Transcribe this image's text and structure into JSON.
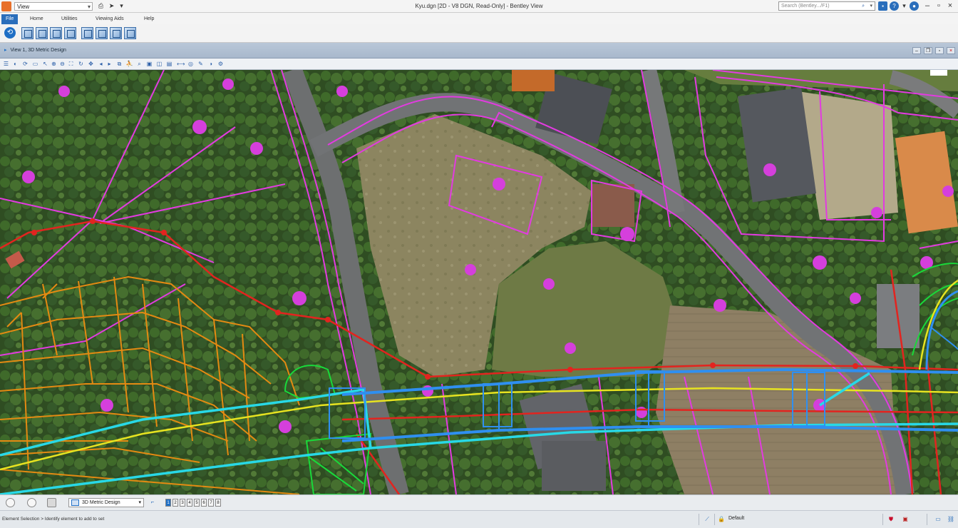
{
  "titlebar": {
    "workflow_value": "View",
    "window_title": "Kyu.dgn [2D - V8 DGN, Read-Only] - Bentley View",
    "search_placeholder": "Search (Bentley.../F1)"
  },
  "ribbon": {
    "tabs": [
      "File",
      "Home",
      "Utilities",
      "Viewing Aids",
      "Help"
    ]
  },
  "view": {
    "title": "View 1, 3D Metric Design"
  },
  "status": {
    "active_model": "3D Metric Design",
    "view_numbers": [
      "1",
      "2",
      "3",
      "4",
      "5",
      "6",
      "7",
      "8"
    ],
    "prompt": "Element Selection > Identify element to add to set",
    "level": "Default"
  },
  "colors": {
    "accent": "#2a6ebb",
    "magenta_linework": "#e23be0",
    "red_alignment": "#e2241f",
    "orange_structure": "#e48a12",
    "cyan_edge": "#28d8e6",
    "blue_road": "#2f8ff0",
    "yellow_centerline": "#e7e320",
    "green_structure": "#19d93a"
  }
}
